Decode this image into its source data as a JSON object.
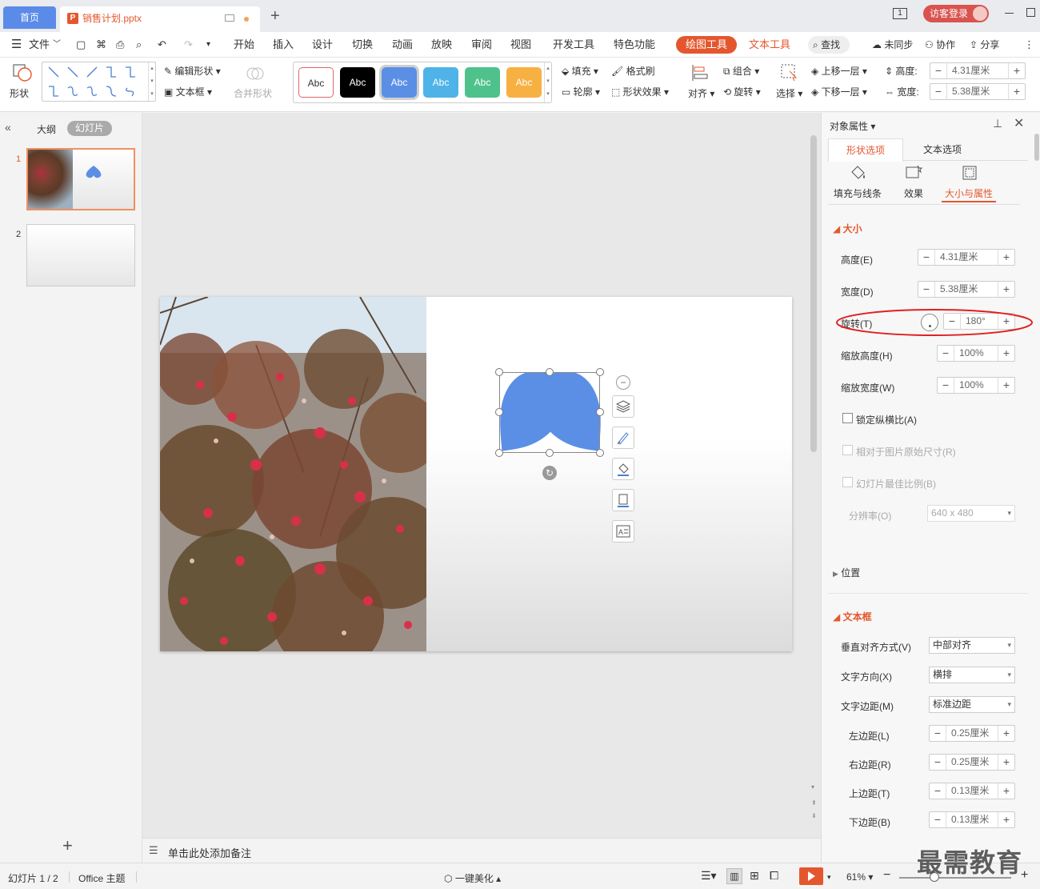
{
  "tabs": {
    "home": "首页",
    "doc": "销售计划.pptx",
    "new_tab": "+"
  },
  "titlebar": {
    "page_badge": "1",
    "login": "访客登录"
  },
  "menu": {
    "file": "文件",
    "items": [
      "开始",
      "插入",
      "设计",
      "切换",
      "动画",
      "放映",
      "审阅",
      "视图",
      "开发工具",
      "特色功能"
    ],
    "drawing_tools": "绘图工具",
    "text_tools": "文本工具",
    "search": "查找",
    "sync": "未同步",
    "collab": "协作",
    "share": "分享"
  },
  "ribbon": {
    "shape": "形状",
    "edit_shape": "编辑形状",
    "text_box": "文本框",
    "merge_shape": "合并形状",
    "styles": [
      "Abc",
      "Abc",
      "Abc",
      "Abc",
      "Abc",
      "Abc"
    ],
    "style_colors": [
      "#ffffff",
      "#000000",
      "#5b8fe6",
      "#4fb3e8",
      "#4fc28c",
      "#f7b042"
    ],
    "fill": "填充",
    "format_painter": "格式刷",
    "outline": "轮廓",
    "shape_effect": "形状效果",
    "align": "对齐",
    "group": "组合",
    "rotate": "旋转",
    "select": "选择",
    "bring_forward": "上移一层",
    "send_backward": "下移一层",
    "height_label": "高度:",
    "height_value": "4.31厘米",
    "width_label": "宽度:",
    "width_value": "5.38厘米"
  },
  "left_panel": {
    "outline_tab": "大纲",
    "slides_tab": "幻灯片",
    "slide_numbers": [
      "1",
      "2"
    ]
  },
  "notes": {
    "placeholder": "单击此处添加备注"
  },
  "right_panel": {
    "title": "对象属性",
    "tab_shape": "形状选项",
    "tab_text": "文本选项",
    "sub_fill": "填充与线条",
    "sub_effect": "效果",
    "sub_size": "大小与属性",
    "section_size": "大小",
    "height_label": "高度(E)",
    "height_value": "4.31厘米",
    "width_label": "宽度(D)",
    "width_value": "5.38厘米",
    "rotate_label": "旋转(T)",
    "rotate_value": "180°",
    "scale_h_label": "缩放高度(H)",
    "scale_h_value": "100%",
    "scale_w_label": "缩放宽度(W)",
    "scale_w_value": "100%",
    "lock_ratio": "锁定纵横比(A)",
    "relative_original": "相对于图片原始尺寸(R)",
    "best_scale": "幻灯片最佳比例(B)",
    "resolution_label": "分辨率(O)",
    "resolution_value": "640 x 480",
    "section_position": "位置",
    "section_textbox": "文本框",
    "valign_label": "垂直对齐方式(V)",
    "valign_value": "中部对齐",
    "direction_label": "文字方向(X)",
    "direction_value": "横排",
    "margin_label": "文字边距(M)",
    "margin_value": "标准边距",
    "left_margin_label": "左边距(L)",
    "left_margin_value": "0.25厘米",
    "right_margin_label": "右边距(R)",
    "right_margin_value": "0.25厘米",
    "top_margin_label": "上边距(T)",
    "top_margin_value": "0.13厘米",
    "bottom_margin_label": "下边距(B)",
    "bottom_margin_value": "0.13厘米"
  },
  "statusbar": {
    "slide_info": "幻灯片 1 / 2",
    "theme": "Office 主题",
    "beautify": "一键美化",
    "zoom": "61%",
    "watermark": "最需教育"
  },
  "colors": {
    "accent": "#e4572e",
    "home_tab": "#5b8be8",
    "heart": "#5b8fe6",
    "highlight_ellipse": "#e02020"
  }
}
